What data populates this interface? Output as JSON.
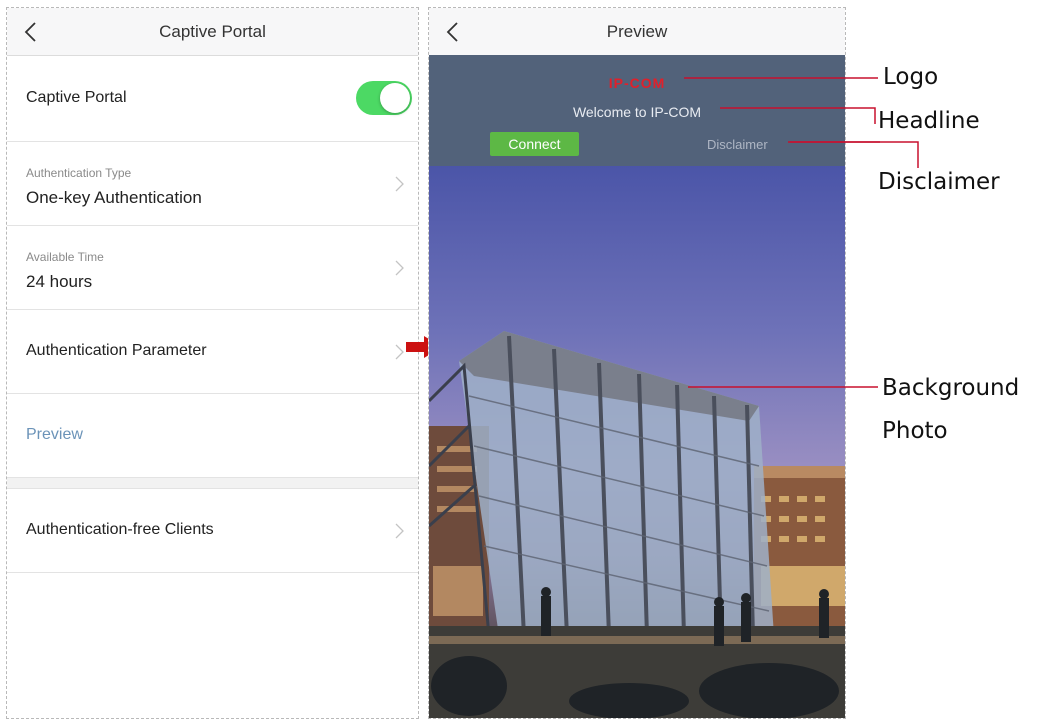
{
  "left_screen": {
    "title": "Captive Portal",
    "captive_portal_label": "Captive Portal",
    "captive_portal_enabled": true,
    "auth_type_label": "Authentication Type",
    "auth_type_value": "One-key Authentication",
    "available_time_label": "Available Time",
    "available_time_value": "24 hours",
    "auth_param_label": "Authentication Parameter",
    "preview_label": "Preview",
    "auth_free_label": "Authentication-free Clients"
  },
  "right_screen": {
    "title": "Preview",
    "logo_text": "IP-COM",
    "headline": "Welcome to IP-COM",
    "connect_label": "Connect",
    "disclaimer_label": "Disclaimer"
  },
  "callouts": {
    "logo": "Logo",
    "headline": "Headline",
    "disclaimer": "Disclaimer",
    "background_line1": "Background",
    "background_line2": "Photo"
  },
  "colors": {
    "toggle_on": "#4cd964",
    "connect_button": "#5db845",
    "logo_red": "#e0202b",
    "callout_line": "#c8102e",
    "preview_link": "#6b93b8"
  }
}
